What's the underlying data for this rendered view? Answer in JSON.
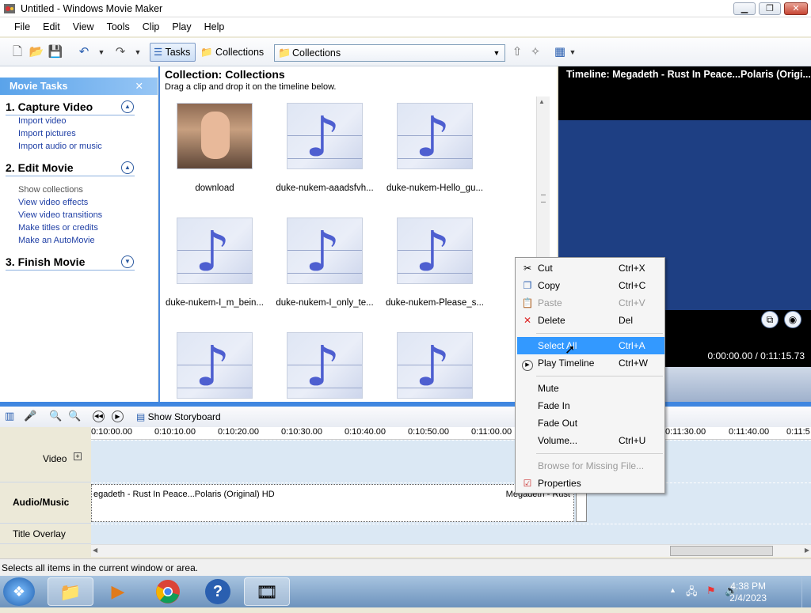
{
  "window": {
    "title": "Untitled - Windows Movie Maker"
  },
  "menu": [
    "File",
    "Edit",
    "View",
    "Tools",
    "Clip",
    "Play",
    "Help"
  ],
  "toolbar": {
    "tasks_label": "Tasks",
    "collections_label": "Collections",
    "collections_combo": "Collections"
  },
  "tasks": {
    "header": "Movie Tasks",
    "sections": [
      {
        "title": "1. Capture Video",
        "links": [
          "Import video",
          "Import pictures",
          "Import audio or music"
        ]
      },
      {
        "title": "2. Edit Movie",
        "links": [
          "Show collections",
          "View video effects",
          "View video transitions",
          "Make titles or credits",
          "Make an AutoMovie"
        ]
      },
      {
        "title": "3. Finish Movie",
        "links": []
      }
    ]
  },
  "collection": {
    "title": "Collection: Collections",
    "subtitle": "Drag a clip and drop it on the timeline below.",
    "items": [
      "download",
      "duke-nukem-aaadsfvh...",
      "duke-nukem-Hello_gu...",
      "duke-nukem-I_m_bein...",
      "duke-nukem-I_only_te...",
      "duke-nukem-Please_s...",
      "",
      "",
      ""
    ]
  },
  "preview": {
    "title": "Timeline: Megadeth - Rust In Peace...Polaris (Origi...",
    "time": "0:00:00.00 / 0:11:15.73"
  },
  "timeline": {
    "show_storyboard": "Show Storyboard",
    "ruler": [
      "0:10:00.00",
      "0:10:10.00",
      "0:10:20.00",
      "0:10:30.00",
      "0:10:40.00",
      "0:10:50.00",
      "0:11:00.00",
      "0:11:30.00",
      "0:11:40.00",
      "0:11:5"
    ],
    "tracks": {
      "video": "Video",
      "audio": "Audio/Music",
      "title": "Title Overlay"
    },
    "audio_clip": "egadeth - Rust In Peace...Polaris (Original) HD",
    "audio_clip_right": "Megadeth - Rust"
  },
  "context_menu": {
    "items": [
      {
        "label": "Cut",
        "shortcut": "Ctrl+X",
        "icon": "scissors-icon",
        "disabled": false
      },
      {
        "label": "Copy",
        "shortcut": "Ctrl+C",
        "icon": "copy-icon",
        "disabled": false
      },
      {
        "label": "Paste",
        "shortcut": "Ctrl+V",
        "icon": "paste-icon",
        "disabled": true
      },
      {
        "label": "Delete",
        "shortcut": "Del",
        "icon": "delete-x-icon",
        "disabled": false
      },
      {
        "label": "Select All",
        "shortcut": "Ctrl+A",
        "highlighted": true
      },
      {
        "label": "Play Timeline",
        "shortcut": "Ctrl+W",
        "icon": "play-icon"
      },
      {
        "label": "Mute"
      },
      {
        "label": "Fade In"
      },
      {
        "label": "Fade Out"
      },
      {
        "label": "Volume...",
        "shortcut": "Ctrl+U"
      },
      {
        "label": "Browse for Missing File...",
        "disabled": true
      },
      {
        "label": "Properties",
        "icon": "properties-icon"
      }
    ]
  },
  "status": "Selects all items in the current window or area.",
  "clock": {
    "time": "4:38 PM",
    "date": "2/4/2023"
  },
  "colors": {
    "accent": "#3f86e0",
    "menu_highlight": "#3399ff",
    "preview_screen": "#1e3f83"
  }
}
